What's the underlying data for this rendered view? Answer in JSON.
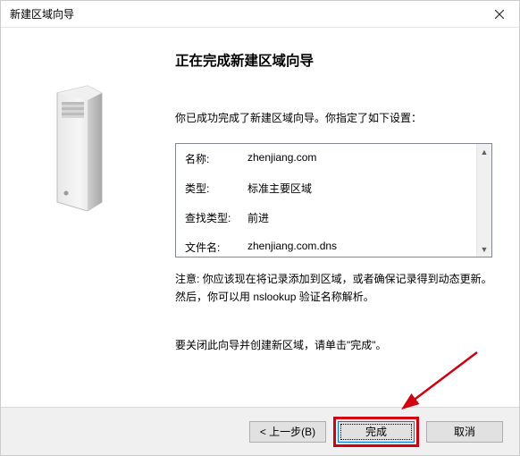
{
  "window": {
    "title": "新建区域向导"
  },
  "main": {
    "heading": "正在完成新建区域向导",
    "intro": "你已成功完成了新建区域向导。你指定了如下设置：",
    "rows": [
      {
        "label": "名称:",
        "value": "zhenjiang.com"
      },
      {
        "label": "类型:",
        "value": "标准主要区域"
      },
      {
        "label": "查找类型:",
        "value": "前进"
      },
      {
        "label": "文件名:",
        "value": "zhenjiang.com.dns"
      }
    ],
    "note": "注意: 你应该现在将记录添加到区域，或者确保记录得到动态更新。然后，你可以用 nslookup 验证名称解析。",
    "close_text": "要关闭此向导并创建新区域，请单击\"完成\"。"
  },
  "buttons": {
    "back": "< 上一步(B)",
    "finish": "完成",
    "cancel": "取消"
  }
}
